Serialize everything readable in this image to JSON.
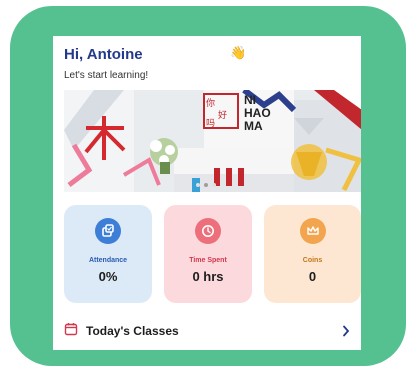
{
  "header": {
    "greeting": "Hi, Antoine",
    "subtitle": "Let's start learning!",
    "wave_emoji": "👋"
  },
  "banner": {
    "sign_lines": [
      "NI",
      "HAO",
      "MA"
    ],
    "sign_chinese": "你好吗",
    "dot_count": 3,
    "active_dot": 1
  },
  "stats": [
    {
      "label": "Attendance",
      "value": "0%",
      "icon": "attendance-icon"
    },
    {
      "label": "Time Spent",
      "value": "0 hrs",
      "icon": "clock-icon"
    },
    {
      "label": "Coins",
      "value": "0",
      "icon": "crown-icon"
    }
  ],
  "classes": {
    "title": "Today's Classes",
    "icon": "calendar-icon"
  },
  "colors": {
    "frame": "#55c090",
    "brand_blue": "#233a8a",
    "attendance_bg": "#dceaf8",
    "time_bg": "#fbd9dd",
    "coins_bg": "#fde7d3"
  }
}
